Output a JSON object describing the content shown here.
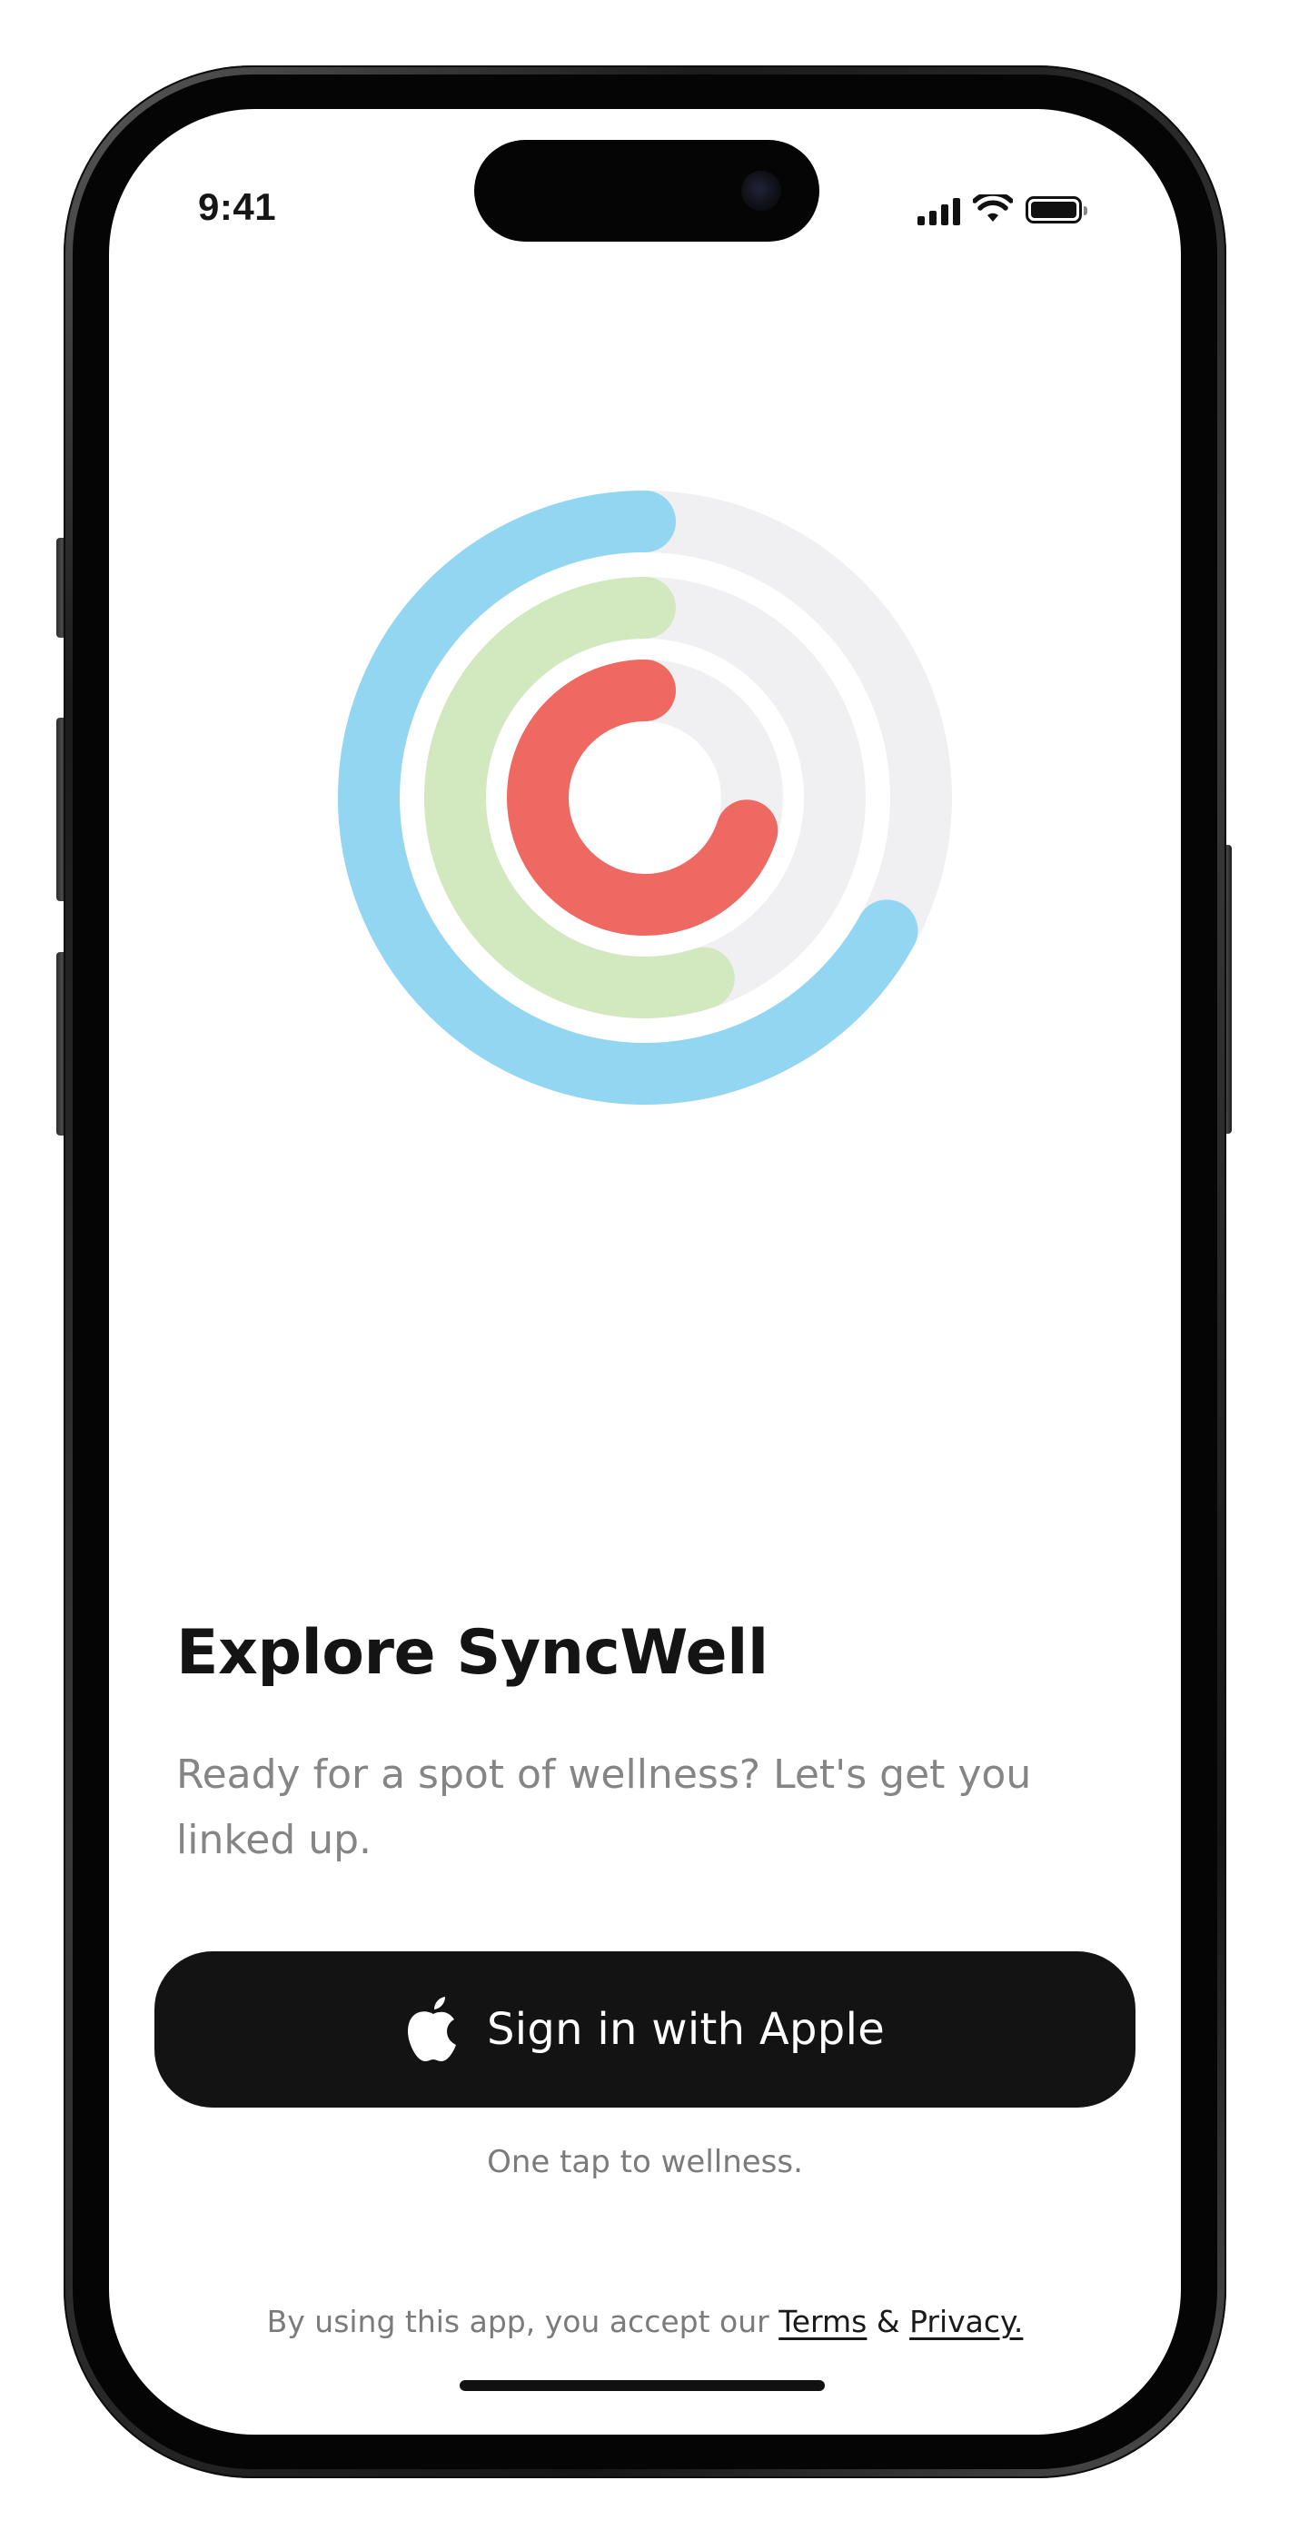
{
  "status_bar": {
    "time": "9:41",
    "icons": [
      "cellular-signal-icon",
      "wifi-icon",
      "battery-icon"
    ]
  },
  "hero": {
    "icon": "activity-rings-icon",
    "rings": [
      {
        "name": "outer",
        "color": "#93D6F1",
        "progress": 0.67
      },
      {
        "name": "middle",
        "color": "#D2E9C0",
        "progress": 0.55
      },
      {
        "name": "inner",
        "color": "#EF6963",
        "progress": 0.7
      }
    ],
    "track_color": "#F0F0F2"
  },
  "onboarding": {
    "title": "Explore SyncWell",
    "subtitle": "Ready for a spot of wellness? Let's get you linked up."
  },
  "sign_in": {
    "icon": "apple-logo-icon",
    "label": "Sign in with Apple",
    "tagline": "One tap to wellness."
  },
  "legal": {
    "prefix": "By using this app, you accept our ",
    "terms": "Terms",
    "joiner": " & ",
    "privacy": "Privacy."
  },
  "colors": {
    "button_bg": "#131313",
    "title": "#141414",
    "muted_text": "#858585"
  }
}
